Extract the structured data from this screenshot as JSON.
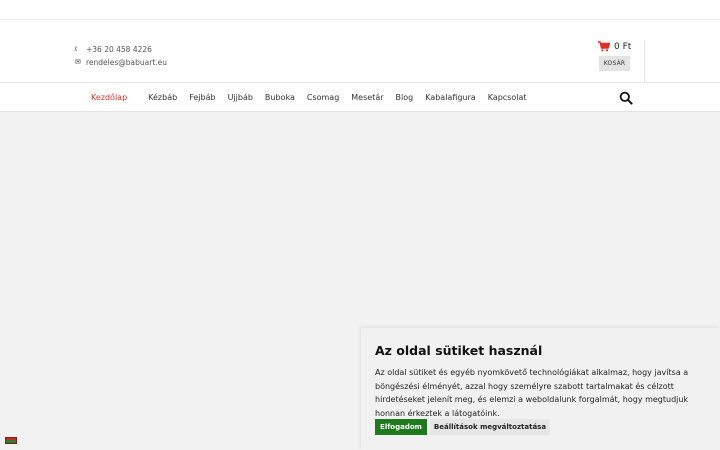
{
  "header": {
    "phone": "+36 20 458 4226",
    "email": "rendeles@babuart.eu",
    "cart": {
      "amount": "0 Ft",
      "button_label": "KOSÁR"
    }
  },
  "nav": {
    "items": [
      {
        "label": "Kezdőlap",
        "active": true
      },
      {
        "label": "Kézbáb",
        "active": false
      },
      {
        "label": "Fejbáb",
        "active": false
      },
      {
        "label": "Ujjbáb",
        "active": false
      },
      {
        "label": "Buboka",
        "active": false
      },
      {
        "label": "Csomag",
        "active": false
      },
      {
        "label": "Mesetár",
        "active": false
      },
      {
        "label": "Blog",
        "active": false
      },
      {
        "label": "Kabalafigura",
        "active": false
      },
      {
        "label": "Kapcsolat",
        "active": false
      }
    ],
    "search_icon": "search-icon"
  },
  "cookie": {
    "title": "Az oldal sütiket használ",
    "text": "Az oldal sütiket és egyéb nyomkövető technológiákat alkalmaz, hogy javítsa a böngészési élményét, azzal hogy személyre szabott tartalmakat és célzott hirdetéseket jelenít meg, és elemzi a weboldalunk forgalmát, hogy megtudjuk honnan érkeztek a látogatóink.",
    "accept_label": "Elfogadom",
    "settings_label": "Beállítások megváltoztatása"
  },
  "colors": {
    "accent": "#d9302c",
    "accept_button": "#1d7b1d"
  }
}
